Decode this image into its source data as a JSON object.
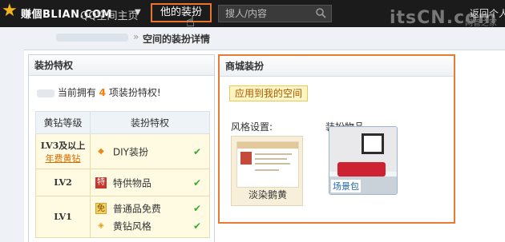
{
  "topbar": {
    "logo_text": "赚個BLIAN.COM",
    "home": "QQ空间主页",
    "mine": "他的装扮",
    "search_placeholder": "搜人/内容",
    "watermark": "itsCN.com",
    "watermark_sub": "网管之家",
    "back": "返回个人"
  },
  "title": {
    "text": "空间的装扮详情"
  },
  "left": {
    "header": "装扮特权",
    "own_prefix": "当前拥有",
    "own_count": "4",
    "own_suffix": "项装扮特权!",
    "table": {
      "col_level": "黄钻等级",
      "col_priv": "装扮特权",
      "rows": [
        {
          "level": "LV3及以上",
          "level_sub": "年费黄钻",
          "items": [
            {
              "icon": "diamond-icon",
              "label": "DIY装扮"
            }
          ]
        },
        {
          "level": "LV2",
          "level_sub": "",
          "items": [
            {
              "icon": "special-icon",
              "label": "特供物品"
            }
          ]
        },
        {
          "level": "LV1",
          "level_sub": "",
          "items": [
            {
              "icon": "free-icon",
              "label": "普通品免费"
            },
            {
              "icon": "tag-icon",
              "label": "黄钻风格"
            }
          ]
        }
      ]
    }
  },
  "right": {
    "header": "商城装扮",
    "apply_button": "应用到我的空间",
    "style_label": "风格设置:",
    "items_label": "装扮物品",
    "style_name": "淡染鹅黄",
    "item_name": "场景包"
  },
  "colors": {
    "accent_orange": "#e87a34",
    "topbar_bg": "#1b1b1b",
    "check_green": "#3aaa35",
    "count_orange": "#ff7a00"
  }
}
